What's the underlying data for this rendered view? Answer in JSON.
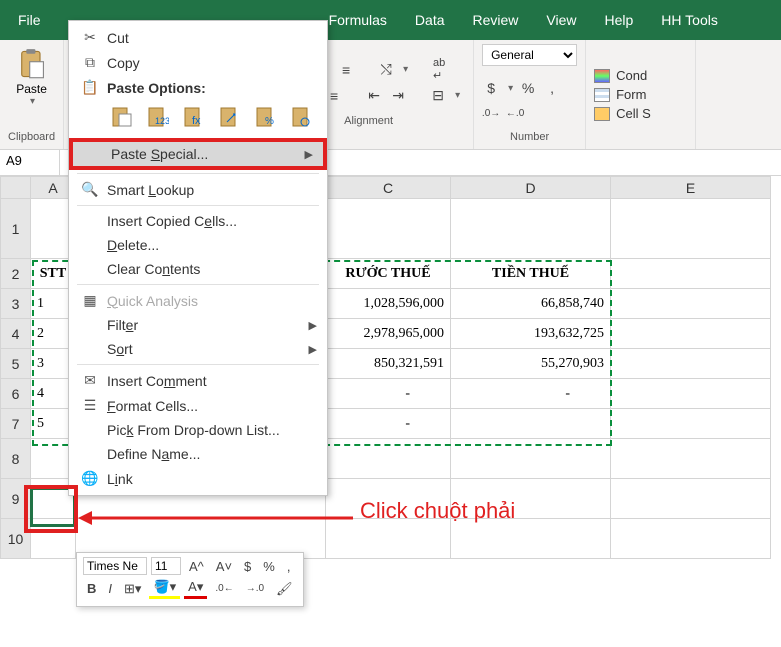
{
  "menubar": {
    "file": "File",
    "formulas": "Formulas",
    "data": "Data",
    "review": "Review",
    "view": "View",
    "help": "Help",
    "hhtools": "HH Tools"
  },
  "ribbon": {
    "paste_label": "Paste",
    "clipboard_label": "Clipboard",
    "alignment_label": "Alignment",
    "number_label": "Number",
    "number_format": "General",
    "cond_fmt": "Cond",
    "format_tbl": "Form",
    "cell_styles": "Cell S"
  },
  "namebox": "A9",
  "columns": [
    "A",
    "",
    "C",
    "D",
    "E"
  ],
  "rowheads": [
    "1",
    "2",
    "3",
    "4",
    "5",
    "6",
    "7",
    "8",
    "9",
    "10"
  ],
  "table": {
    "h_stt": "STT",
    "h_truoc": "RƯỚC THUẾ",
    "h_tien": "TIỀN THUẾ",
    "rows": [
      {
        "stt": "1",
        "c": "1,028,596,000",
        "d": "66,858,740"
      },
      {
        "stt": "2",
        "c": "2,978,965,000",
        "d": "193,632,725"
      },
      {
        "stt": "3",
        "c": "850,321,591",
        "d": "55,270,903"
      },
      {
        "stt": "4",
        "c": "-",
        "d": "-"
      },
      {
        "stt": "5",
        "c": "-",
        "d": ""
      }
    ]
  },
  "ctx": {
    "cut": "Cut",
    "copy": "Copy",
    "paste_options": "Paste Options:",
    "paste_special": "Paste Special...",
    "smart_lookup": "Smart Lookup",
    "insert_copied": "Insert Copied Cells...",
    "delete": "Delete...",
    "clear": "Clear Contents",
    "quick_analysis": "Quick Analysis",
    "filter": "Filter",
    "sort": "Sort",
    "insert_comment": "Insert Comment",
    "format_cells": "Format Cells...",
    "pick_list": "Pick From Drop-down List...",
    "define_name": "Define Name...",
    "link": "Link"
  },
  "minitb": {
    "font": "Times Ne",
    "size": "11",
    "bold": "B",
    "italic": "I"
  },
  "annotation": "Click chuột phải",
  "colors": {
    "excel_green": "#217346",
    "red": "#e02020"
  }
}
